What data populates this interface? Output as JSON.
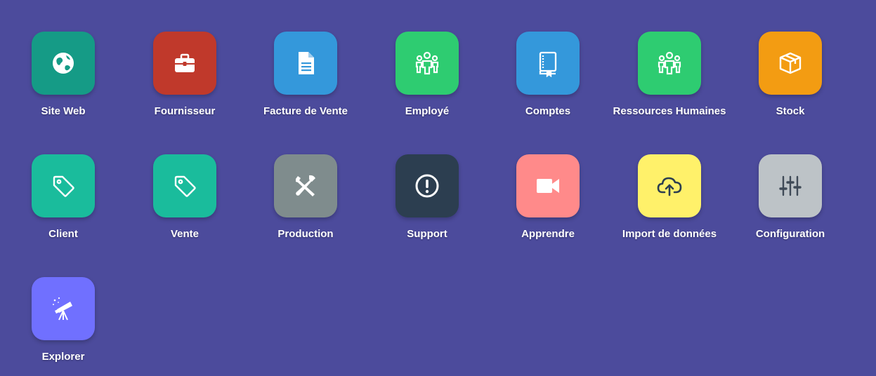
{
  "apps": [
    {
      "label": "Site Web",
      "icon": "globe-icon",
      "color": "#159b86"
    },
    {
      "label": "Fournisseur",
      "icon": "briefcase-icon",
      "color": "#c0392b"
    },
    {
      "label": "Facture de Vente",
      "icon": "document-icon",
      "color": "#3498db"
    },
    {
      "label": "Employé",
      "icon": "users-icon",
      "color": "#2ecc71"
    },
    {
      "label": "Comptes",
      "icon": "book-icon",
      "color": "#3498db"
    },
    {
      "label": "Ressources Humaines",
      "icon": "users-icon",
      "color": "#2ecc71"
    },
    {
      "label": "Stock",
      "icon": "box-icon",
      "color": "#f39c12"
    },
    {
      "label": "Client",
      "icon": "tag-icon",
      "color": "#1abc9c"
    },
    {
      "label": "Vente",
      "icon": "tag-icon",
      "color": "#1abc9c"
    },
    {
      "label": "Production",
      "icon": "tools-icon",
      "color": "#7f8c8d"
    },
    {
      "label": "Support",
      "icon": "alert-circle-icon",
      "color": "#2c3e50"
    },
    {
      "label": "Apprendre",
      "icon": "video-camera-icon",
      "color": "#ff8a8a"
    },
    {
      "label": "Import de données",
      "icon": "cloud-upload-icon",
      "color": "#fff16a"
    },
    {
      "label": "Configuration",
      "icon": "sliders-icon",
      "color": "#bdc3c7"
    },
    {
      "label": "Explorer",
      "icon": "telescope-icon",
      "color": "#7070ff"
    }
  ]
}
